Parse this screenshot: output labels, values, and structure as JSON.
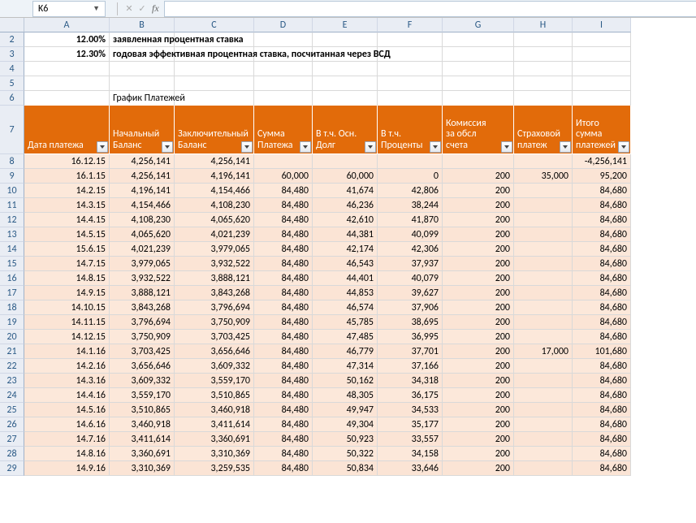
{
  "nameBox": "K6",
  "fxLabel": "fx",
  "fxValue": "",
  "columns": [
    "A",
    "B",
    "C",
    "D",
    "E",
    "F",
    "G",
    "H",
    "I"
  ],
  "prelude": {
    "r2_A": "12.00%",
    "r2_B": "заявленная процентная ставка",
    "r3_A": "12.30%",
    "r3_B": "годовая эффективная процентная ставка, посчитанная через ВСД",
    "r6_B": "График Платежей"
  },
  "headers": {
    "A": "Дата платежа",
    "B": "Начальный Баланс",
    "C": "Заключительный Баланс",
    "D": "Сумма Платежа",
    "E": "В т.ч. Осн. Долг",
    "F": "В т.ч. Проценты",
    "G": "Комиссия за обсл счета",
    "H": "Страховой платеж",
    "I": "Итого сумма платежей"
  },
  "rows": [
    {
      "n": 8,
      "A": "16.12.15",
      "B": "4,256,141",
      "C": "4,256,141",
      "D": "",
      "E": "",
      "F": "",
      "G": "",
      "H": "",
      "I": "-4,256,141"
    },
    {
      "n": 9,
      "A": "16.1.15",
      "B": "4,256,141",
      "C": "4,196,141",
      "D": "60,000",
      "E": "60,000",
      "F": "0",
      "G": "200",
      "H": "35,000",
      "I": "95,200"
    },
    {
      "n": 10,
      "A": "14.2.15",
      "B": "4,196,141",
      "C": "4,154,466",
      "D": "84,480",
      "E": "41,674",
      "F": "42,806",
      "G": "200",
      "H": "",
      "I": "84,680"
    },
    {
      "n": 11,
      "A": "14.3.15",
      "B": "4,154,466",
      "C": "4,108,230",
      "D": "84,480",
      "E": "46,236",
      "F": "38,244",
      "G": "200",
      "H": "",
      "I": "84,680"
    },
    {
      "n": 12,
      "A": "14.4.15",
      "B": "4,108,230",
      "C": "4,065,620",
      "D": "84,480",
      "E": "42,610",
      "F": "41,870",
      "G": "200",
      "H": "",
      "I": "84,680"
    },
    {
      "n": 13,
      "A": "14.5.15",
      "B": "4,065,620",
      "C": "4,021,239",
      "D": "84,480",
      "E": "44,381",
      "F": "40,099",
      "G": "200",
      "H": "",
      "I": "84,680"
    },
    {
      "n": 14,
      "A": "15.6.15",
      "B": "4,021,239",
      "C": "3,979,065",
      "D": "84,480",
      "E": "42,174",
      "F": "42,306",
      "G": "200",
      "H": "",
      "I": "84,680"
    },
    {
      "n": 15,
      "A": "14.7.15",
      "B": "3,979,065",
      "C": "3,932,522",
      "D": "84,480",
      "E": "46,543",
      "F": "37,937",
      "G": "200",
      "H": "",
      "I": "84,680"
    },
    {
      "n": 16,
      "A": "14.8.15",
      "B": "3,932,522",
      "C": "3,888,121",
      "D": "84,480",
      "E": "44,401",
      "F": "40,079",
      "G": "200",
      "H": "",
      "I": "84,680"
    },
    {
      "n": 17,
      "A": "14.9.15",
      "B": "3,888,121",
      "C": "3,843,268",
      "D": "84,480",
      "E": "44,853",
      "F": "39,627",
      "G": "200",
      "H": "",
      "I": "84,680"
    },
    {
      "n": 18,
      "A": "14.10.15",
      "B": "3,843,268",
      "C": "3,796,694",
      "D": "84,480",
      "E": "46,574",
      "F": "37,906",
      "G": "200",
      "H": "",
      "I": "84,680"
    },
    {
      "n": 19,
      "A": "14.11.15",
      "B": "3,796,694",
      "C": "3,750,909",
      "D": "84,480",
      "E": "45,785",
      "F": "38,695",
      "G": "200",
      "H": "",
      "I": "84,680"
    },
    {
      "n": 20,
      "A": "14.12.15",
      "B": "3,750,909",
      "C": "3,703,425",
      "D": "84,480",
      "E": "47,485",
      "F": "36,995",
      "G": "200",
      "H": "",
      "I": "84,680"
    },
    {
      "n": 21,
      "A": "14.1.16",
      "B": "3,703,425",
      "C": "3,656,646",
      "D": "84,480",
      "E": "46,779",
      "F": "37,701",
      "G": "200",
      "H": "17,000",
      "I": "101,680"
    },
    {
      "n": 22,
      "A": "14.2.16",
      "B": "3,656,646",
      "C": "3,609,332",
      "D": "84,480",
      "E": "47,314",
      "F": "37,166",
      "G": "200",
      "H": "",
      "I": "84,680"
    },
    {
      "n": 23,
      "A": "14.3.16",
      "B": "3,609,332",
      "C": "3,559,170",
      "D": "84,480",
      "E": "50,162",
      "F": "34,318",
      "G": "200",
      "H": "",
      "I": "84,680"
    },
    {
      "n": 24,
      "A": "14.4.16",
      "B": "3,559,170",
      "C": "3,510,865",
      "D": "84,480",
      "E": "48,305",
      "F": "36,175",
      "G": "200",
      "H": "",
      "I": "84,680"
    },
    {
      "n": 25,
      "A": "14.5.16",
      "B": "3,510,865",
      "C": "3,460,918",
      "D": "84,480",
      "E": "49,947",
      "F": "34,533",
      "G": "200",
      "H": "",
      "I": "84,680"
    },
    {
      "n": 26,
      "A": "14.6.16",
      "B": "3,460,918",
      "C": "3,411,614",
      "D": "84,480",
      "E": "49,304",
      "F": "35,177",
      "G": "200",
      "H": "",
      "I": "84,680"
    },
    {
      "n": 27,
      "A": "14.7.16",
      "B": "3,411,614",
      "C": "3,360,691",
      "D": "84,480",
      "E": "50,923",
      "F": "33,557",
      "G": "200",
      "H": "",
      "I": "84,680"
    },
    {
      "n": 28,
      "A": "14.8.16",
      "B": "3,360,691",
      "C": "3,310,369",
      "D": "84,480",
      "E": "50,322",
      "F": "34,158",
      "G": "200",
      "H": "",
      "I": "84,680"
    },
    {
      "n": 29,
      "A": "14.9.16",
      "B": "3,310,369",
      "C": "3,259,535",
      "D": "84,480",
      "E": "50,834",
      "F": "33,646",
      "G": "200",
      "H": "",
      "I": "84,680"
    }
  ]
}
